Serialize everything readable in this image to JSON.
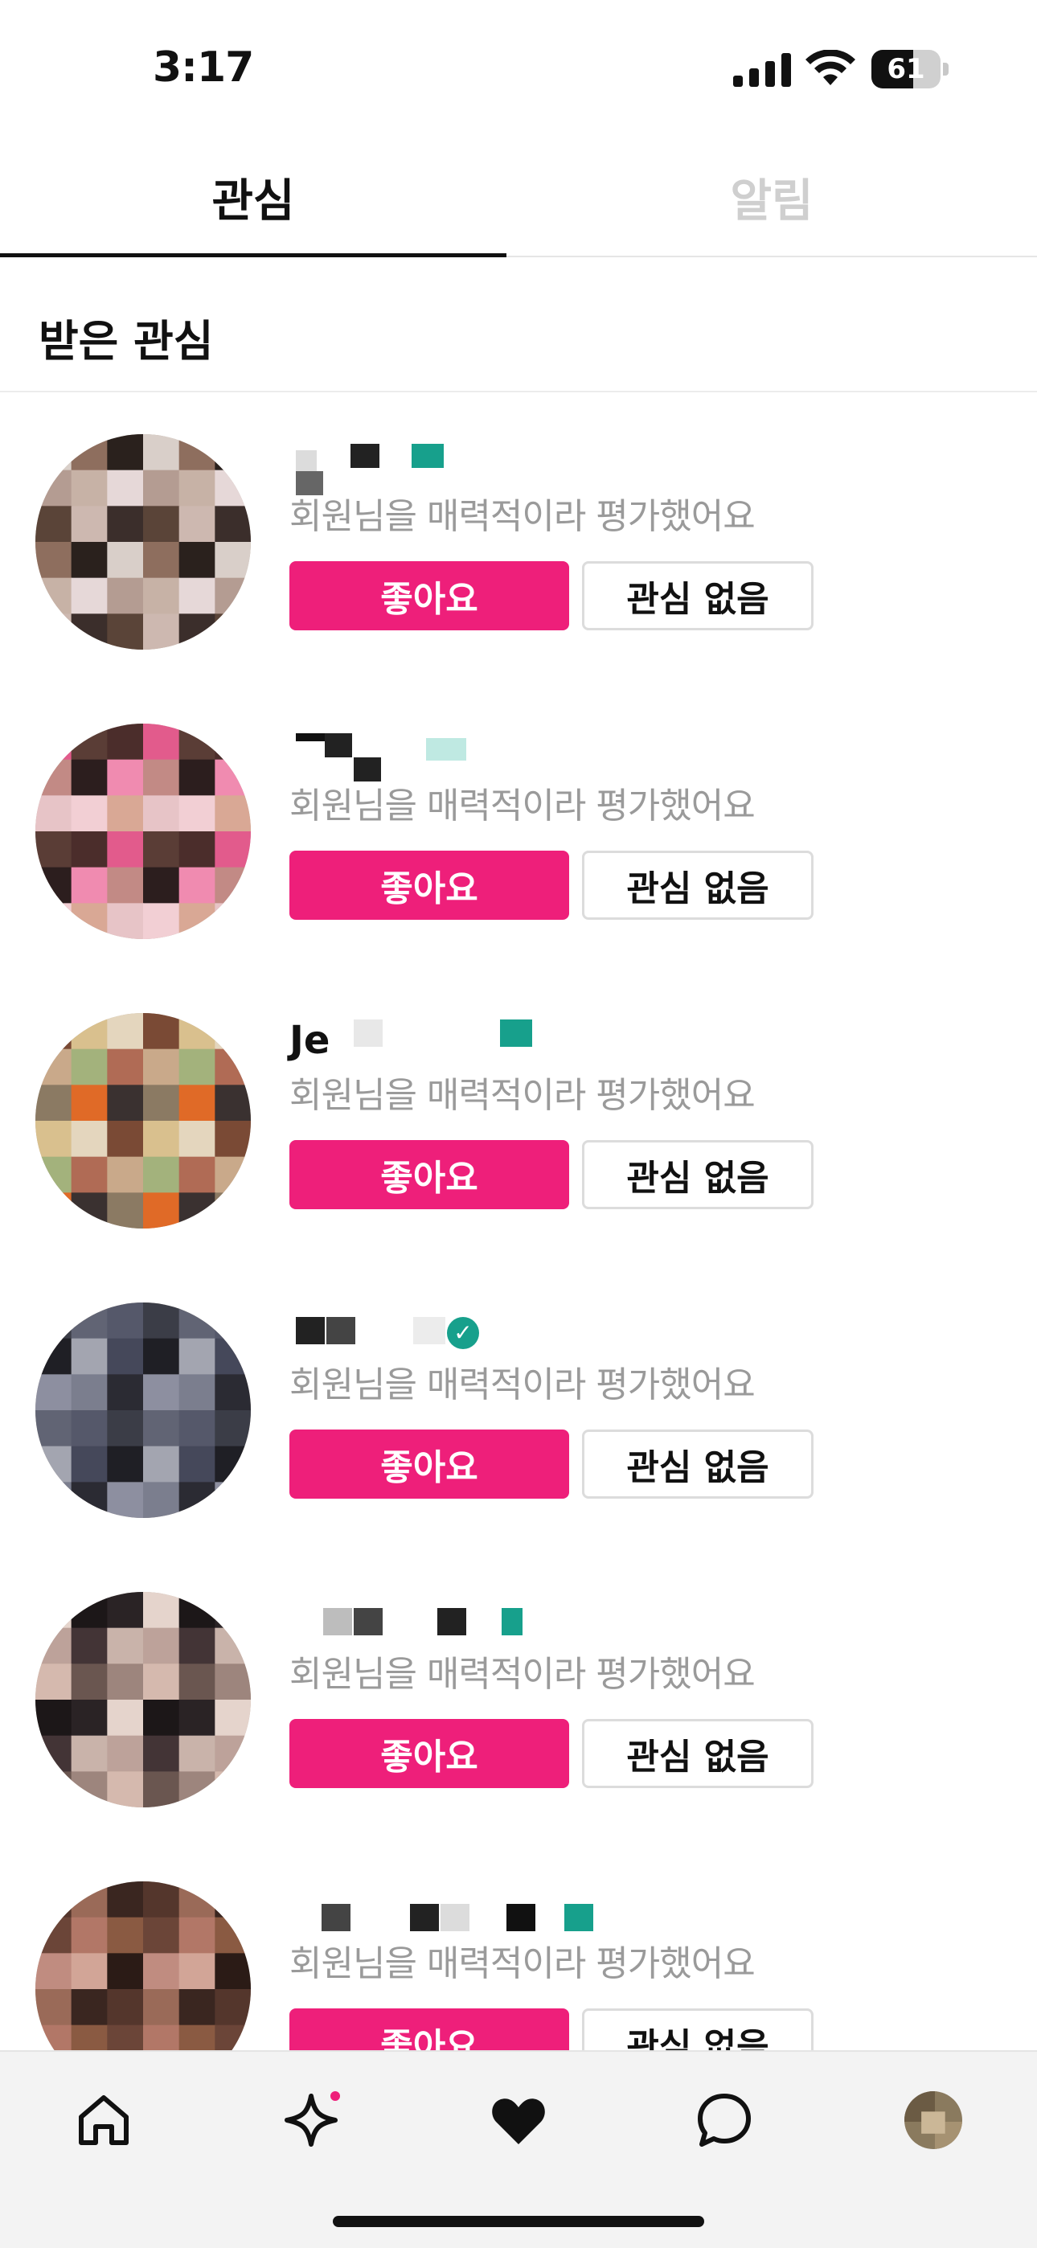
{
  "status_bar": {
    "time": "3:17",
    "battery_level": "61"
  },
  "tabs": [
    {
      "label": "관심",
      "active": true
    },
    {
      "label": "알림",
      "active": false
    }
  ],
  "section_title": "받은 관심",
  "cards": [
    {
      "name": "",
      "description": "회원님을 매력적이라 평가했어요",
      "like_label": "좋아요",
      "pass_label": "관심 없음"
    },
    {
      "name": "",
      "description": "회원님을 매력적이라 평가했어요",
      "like_label": "좋아요",
      "pass_label": "관심 없음"
    },
    {
      "name": "Je",
      "description": "회원님을 매력적이라 평가했어요",
      "like_label": "좋아요",
      "pass_label": "관심 없음"
    },
    {
      "name": "",
      "description": "회원님을 매력적이라 평가했어요",
      "like_label": "좋아요",
      "pass_label": "관심 없음"
    },
    {
      "name": "",
      "description": "회원님을 매력적이라 평가했어요",
      "like_label": "좋아요",
      "pass_label": "관심 없음"
    },
    {
      "name": "",
      "description": "회원님을 매력적이라 평가했어요",
      "like_label": "좋아요",
      "pass_label": "관심 없음"
    }
  ],
  "bottom_nav": [
    {
      "icon": "home-icon"
    },
    {
      "icon": "sparkle-icon",
      "badge": true
    },
    {
      "icon": "heart-icon"
    },
    {
      "icon": "chat-bubble-icon"
    },
    {
      "icon": "profile-avatar"
    }
  ],
  "colors": {
    "accent": "#ee1f7a",
    "verified": "#17a08c",
    "muted_text": "#9a9a9a",
    "inactive_tab": "#cfcfcf"
  }
}
